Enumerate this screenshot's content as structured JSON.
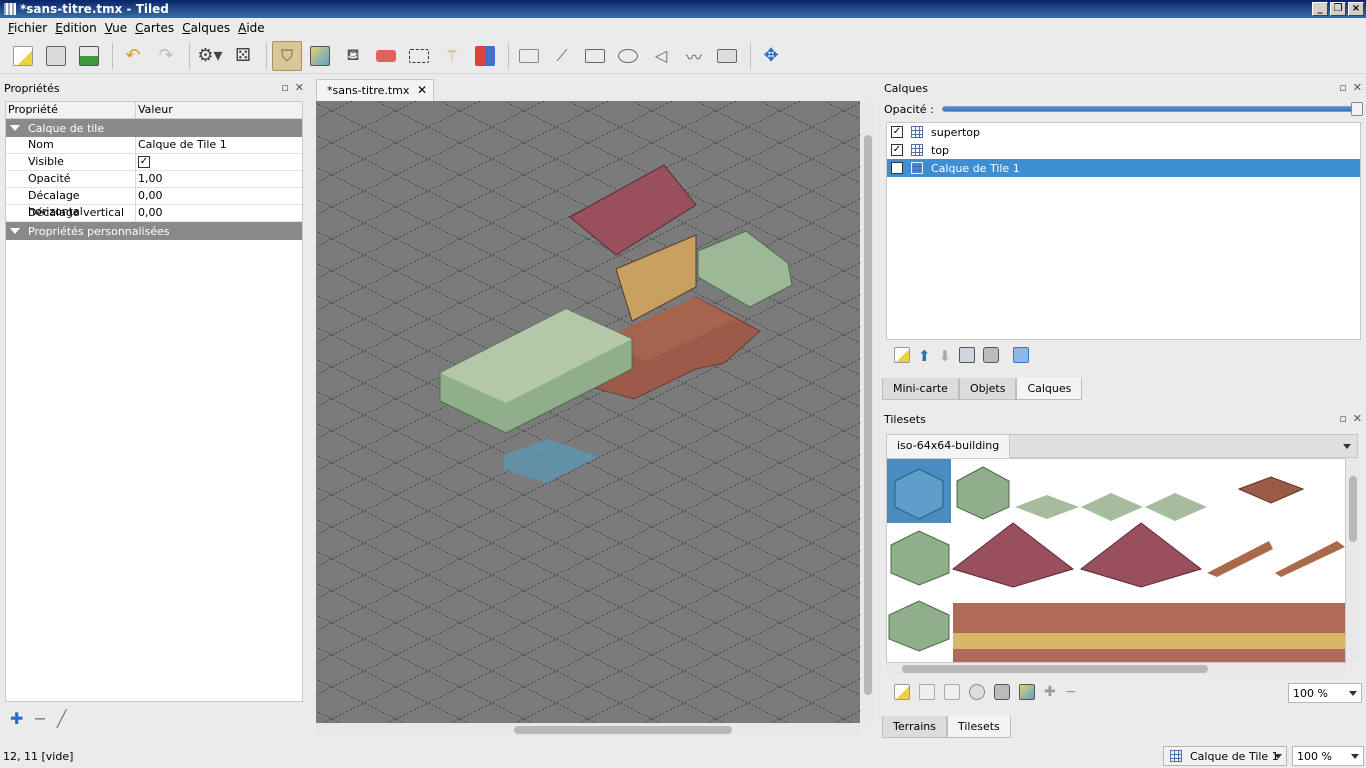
{
  "window": {
    "title": "*sans-titre.tmx - Tiled"
  },
  "menu": [
    "Fichier",
    "Edition",
    "Vue",
    "Cartes",
    "Calques",
    "Aide"
  ],
  "toolbar": {
    "file_tools": [
      "new-icon",
      "open-icon",
      "save-icon",
      "undo-icon",
      "redo-icon",
      "commands-icon",
      "random-icon"
    ],
    "edit_tools": [
      "stamp-brush-icon",
      "terrain-brush-icon",
      "bucket-fill-icon",
      "eraser-icon",
      "rect-select-icon",
      "magic-wand-icon",
      "select-same-tile-icon"
    ],
    "object_tools": [
      "select-objects-icon",
      "edit-polygons-icon",
      "insert-rectangle-icon",
      "insert-ellipse-icon",
      "insert-polygon-icon",
      "insert-polyline-icon",
      "insert-tile-icon"
    ],
    "move_tool": "move-icon"
  },
  "properties": {
    "title": "Propriétés",
    "col_property": "Propriété",
    "col_value": "Valeur",
    "group_layer": "Calque de tile",
    "rows": [
      {
        "name": "Nom",
        "value": "Calque de Tile 1"
      },
      {
        "name": "Visible",
        "value": "✓"
      },
      {
        "name": "Opacité",
        "value": "1,00"
      },
      {
        "name": "Décalage horizontal",
        "value": "0,00"
      },
      {
        "name": "Décalage vertical",
        "value": "0,00"
      }
    ],
    "group_custom": "Propriétés personnalisées"
  },
  "editor": {
    "tab_label": "*sans-titre.tmx"
  },
  "layers": {
    "title": "Calques",
    "opacity_label": "Opacité :",
    "opacity_value": 1.0,
    "items": [
      {
        "name": "supertop",
        "visible": "✓",
        "selected": false
      },
      {
        "name": "top",
        "visible": "✓",
        "selected": false
      },
      {
        "name": "Calque de Tile 1",
        "visible": "✓",
        "selected": true
      }
    ],
    "tabs": [
      "Mini-carte",
      "Objets",
      "Calques"
    ],
    "active_tab": "Calques"
  },
  "tilesets": {
    "title": "Tilesets",
    "tab": "iso-64x64-building",
    "zoom": "100 %",
    "tabs": [
      "Terrains",
      "Tilesets"
    ],
    "active_tab": "Tilesets"
  },
  "status": {
    "position": "12, 11 [vide]",
    "layer": "Calque de Tile 1",
    "zoom": "100 %"
  },
  "colors": {
    "selection": "#3d8ed3",
    "title_bar": "#0a246a",
    "canvas_bg": "#7b7b7b",
    "wall": "#8fae8a",
    "roof": "#9a4f5c",
    "floor": "#9c5a4a",
    "selected_tile": "#4a8bc0"
  }
}
